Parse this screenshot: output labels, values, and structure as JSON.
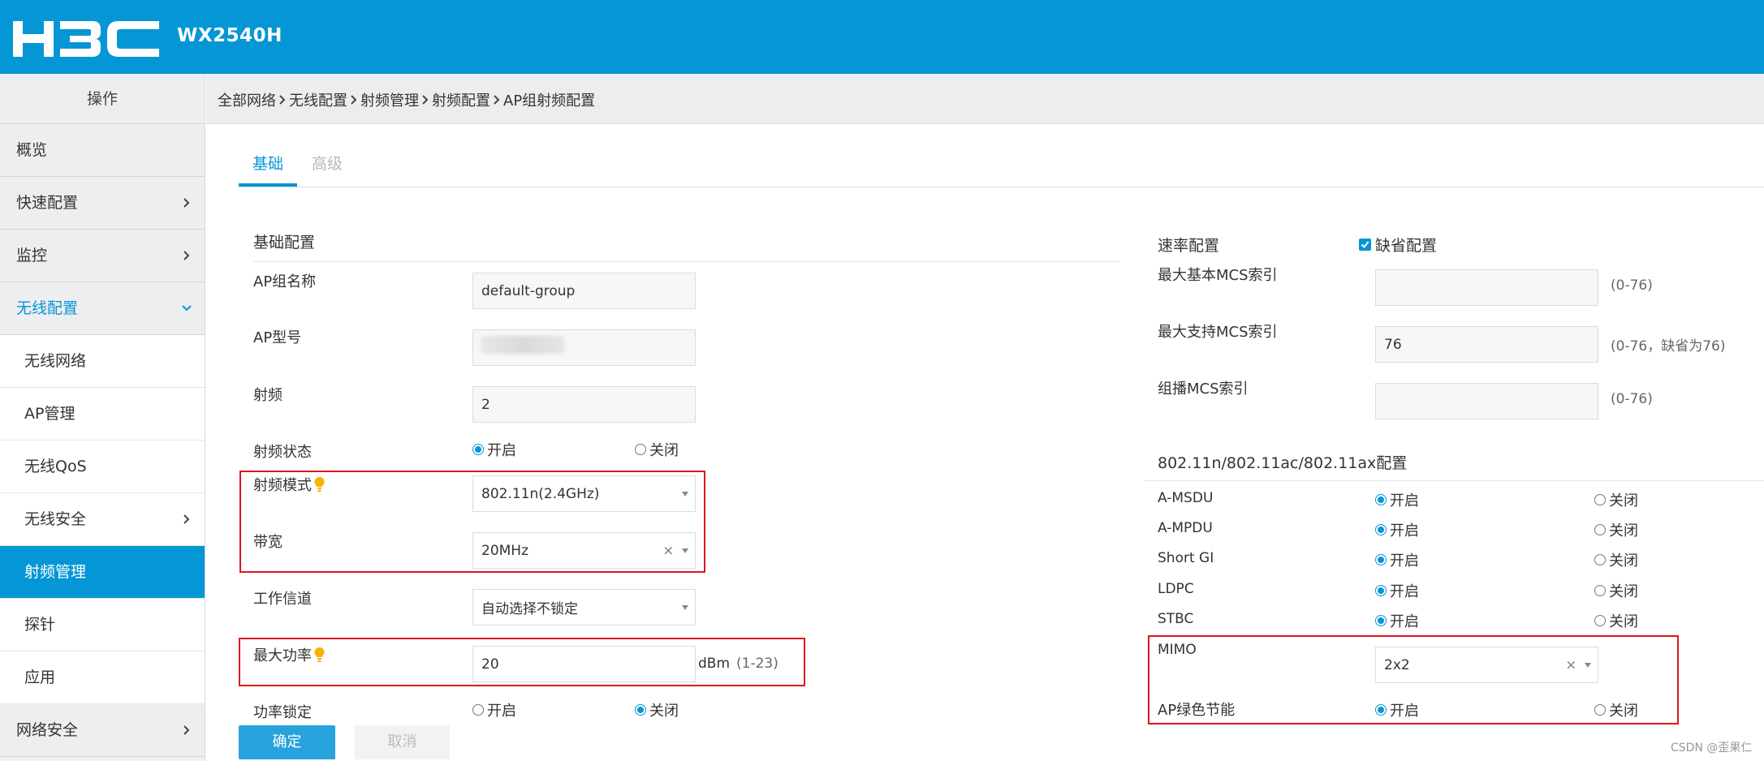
{
  "header": {
    "model": "WX2540H",
    "logo_text": "H3C"
  },
  "sidebar": {
    "heading": "操作",
    "items": [
      {
        "label": "概览"
      },
      {
        "label": "快速配置"
      },
      {
        "label": "监控"
      },
      {
        "label": "无线配置"
      },
      {
        "label": "无线网络"
      },
      {
        "label": "AP管理"
      },
      {
        "label": "无线QoS"
      },
      {
        "label": "无线安全"
      },
      {
        "label": "射频管理"
      },
      {
        "label": "探针"
      },
      {
        "label": "应用"
      },
      {
        "label": "网络安全"
      }
    ]
  },
  "breadcrumb": [
    "全部网络",
    "无线配置",
    "射频管理",
    "射频配置",
    "AP组射频配置"
  ],
  "tabs": [
    {
      "label": "基础"
    },
    {
      "label": "高级"
    }
  ],
  "basic": {
    "section_title": "基础配置",
    "ap_group_label": "AP组名称",
    "ap_group_value": "default-group",
    "ap_model_label": "AP型号",
    "radio_label": "射频",
    "radio_value": "2",
    "radio_state_label": "射频状态",
    "radio_mode_label": "射频模式",
    "radio_mode_value": "802.11n(2.4GHz)",
    "bandwidth_label": "带宽",
    "bandwidth_value": "20MHz",
    "channel_label": "工作信道",
    "channel_value": "自动选择不锁定",
    "max_power_label": "最大功率",
    "max_power_value": "20",
    "max_power_unit": "dBm",
    "max_power_range": "(1-23)",
    "power_lock_label": "功率锁定",
    "on": "开启",
    "off": "关闭"
  },
  "rate": {
    "section_title": "速率配置",
    "default_label": "缺省配置",
    "max_basic_mcs_label": "最大基本MCS索引",
    "max_basic_mcs_hint": "(0-76)",
    "max_support_mcs_label": "最大支持MCS索引",
    "max_support_mcs_value": "76",
    "max_support_mcs_hint": "(0-76，缺省为76)",
    "multicast_mcs_label": "组播MCS索引",
    "multicast_mcs_hint": "(0-76)"
  },
  "n_section": {
    "title": "802.11n/802.11ac/802.11ax配置",
    "rows": [
      "A-MSDU",
      "A-MPDU",
      "Short GI",
      "LDPC",
      "STBC"
    ],
    "mimo_label": "MIMO",
    "mimo_value": "2x2",
    "green_label": "AP绿色节能"
  },
  "buttons": {
    "ok": "确定",
    "cancel": "取消"
  },
  "watermark": "CSDN @歪果仁",
  "colors": {
    "brand": "#0596d6",
    "highlight_box": "#e0161d"
  }
}
